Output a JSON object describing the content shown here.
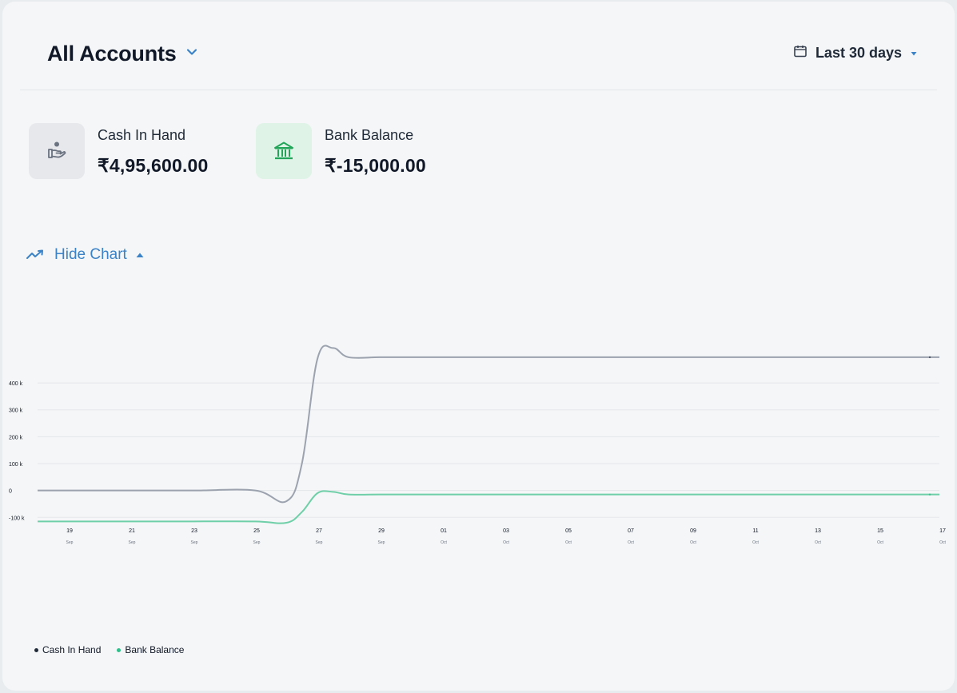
{
  "header": {
    "title": "All Accounts",
    "range_label": "Last 30 days",
    "icons": [
      "chevron-down-icon",
      "calendar-icon",
      "caret-down-icon"
    ]
  },
  "accounts": [
    {
      "label": "Cash In Hand",
      "value": "₹4,95,600.00",
      "icon": "cash-hand-icon",
      "icon_bg": "#e6e8ec",
      "icon_color": "#6b7280"
    },
    {
      "label": "Bank Balance",
      "value": "₹-15,000.00",
      "icon": "bank-icon",
      "icon_bg": "#dff3e7",
      "icon_color": "#22a559"
    }
  ],
  "chart_toggle": {
    "label": "Hide Chart",
    "icon": "trend-up-icon",
    "color": "#3b82c6"
  },
  "chart_data": {
    "type": "line",
    "y_tick_labels": [
      "400 k",
      "300 k",
      "200 k",
      "100 k",
      "0",
      "-100 k"
    ],
    "y_ticks": [
      400000,
      300000,
      200000,
      100000,
      0,
      -100000
    ],
    "ylim": [
      -120000,
      540000
    ],
    "grid": true,
    "x_tick_labels": [
      {
        "day": "19",
        "month": "Sep"
      },
      {
        "day": "21",
        "month": "Sep"
      },
      {
        "day": "23",
        "month": "Sep"
      },
      {
        "day": "25",
        "month": "Sep"
      },
      {
        "day": "27",
        "month": "Sep"
      },
      {
        "day": "29",
        "month": "Sep"
      },
      {
        "day": "01",
        "month": "Oct"
      },
      {
        "day": "03",
        "month": "Oct"
      },
      {
        "day": "05",
        "month": "Oct"
      },
      {
        "day": "07",
        "month": "Oct"
      },
      {
        "day": "09",
        "month": "Oct"
      },
      {
        "day": "11",
        "month": "Oct"
      },
      {
        "day": "13",
        "month": "Oct"
      },
      {
        "day": "15",
        "month": "Oct"
      },
      {
        "day": "17",
        "month": "Oct"
      }
    ],
    "series": [
      {
        "name": "Cash In Hand",
        "color": "#9ca3af",
        "legend_color": "#1f2937",
        "points": [
          [
            18,
            0
          ],
          [
            19,
            0
          ],
          [
            21,
            0
          ],
          [
            23,
            0
          ],
          [
            25,
            0
          ],
          [
            26,
            -40000
          ],
          [
            26.5,
            100000
          ],
          [
            27,
            490000
          ],
          [
            27.5,
            530000
          ],
          [
            28,
            495600
          ],
          [
            29,
            495600
          ],
          [
            30,
            495600
          ],
          [
            31,
            495600
          ],
          [
            32,
            495600
          ],
          [
            33,
            495600
          ],
          [
            35,
            495600
          ],
          [
            37,
            495600
          ],
          [
            39,
            495600
          ],
          [
            41,
            495600
          ],
          [
            43,
            495600
          ],
          [
            45,
            495600
          ],
          [
            47,
            495600
          ]
        ]
      },
      {
        "name": "Bank Balance",
        "color": "#6fcfa8",
        "legend_color": "#2fbf8a",
        "points": [
          [
            18,
            -115000
          ],
          [
            19,
            -115000
          ],
          [
            21,
            -115000
          ],
          [
            23,
            -115000
          ],
          [
            25,
            -115000
          ],
          [
            26,
            -120000
          ],
          [
            26.5,
            -80000
          ],
          [
            27,
            -10000
          ],
          [
            27.5,
            -5000
          ],
          [
            28,
            -15000
          ],
          [
            29,
            -15000
          ],
          [
            31,
            -15000
          ],
          [
            33,
            -15000
          ],
          [
            35,
            -15000
          ],
          [
            37,
            -15000
          ],
          [
            39,
            -15000
          ],
          [
            41,
            -15000
          ],
          [
            43,
            -15000
          ],
          [
            45,
            -15000
          ],
          [
            47,
            -15000
          ]
        ]
      }
    ],
    "x_range": [
      18,
      47
    ]
  }
}
